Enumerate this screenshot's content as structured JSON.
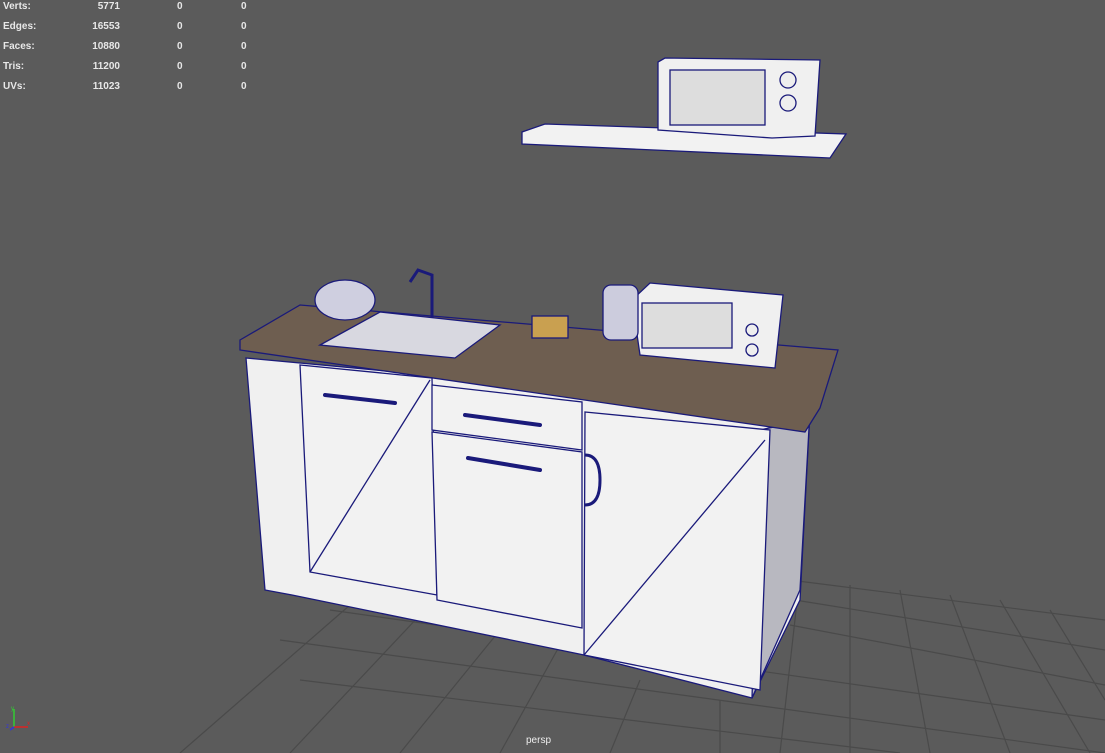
{
  "hud": {
    "rows": [
      {
        "label": "Verts:",
        "values": [
          "5771",
          "0",
          "0"
        ]
      },
      {
        "label": "Edges:",
        "values": [
          "16553",
          "0",
          "0"
        ]
      },
      {
        "label": "Faces:",
        "values": [
          "10880",
          "0",
          "0"
        ]
      },
      {
        "label": "Tris:",
        "values": [
          "11200",
          "0",
          "0"
        ]
      },
      {
        "label": "UVs:",
        "values": [
          "11023",
          "0",
          "0"
        ]
      }
    ]
  },
  "camera_label": "persp",
  "axis": {
    "y": "y",
    "x": "x",
    "z": "z"
  },
  "colors": {
    "background": "#5b5b5b",
    "wireframe": "#1a1a7a",
    "surface": "#f2f2f2",
    "counter": "#6e5e50"
  }
}
